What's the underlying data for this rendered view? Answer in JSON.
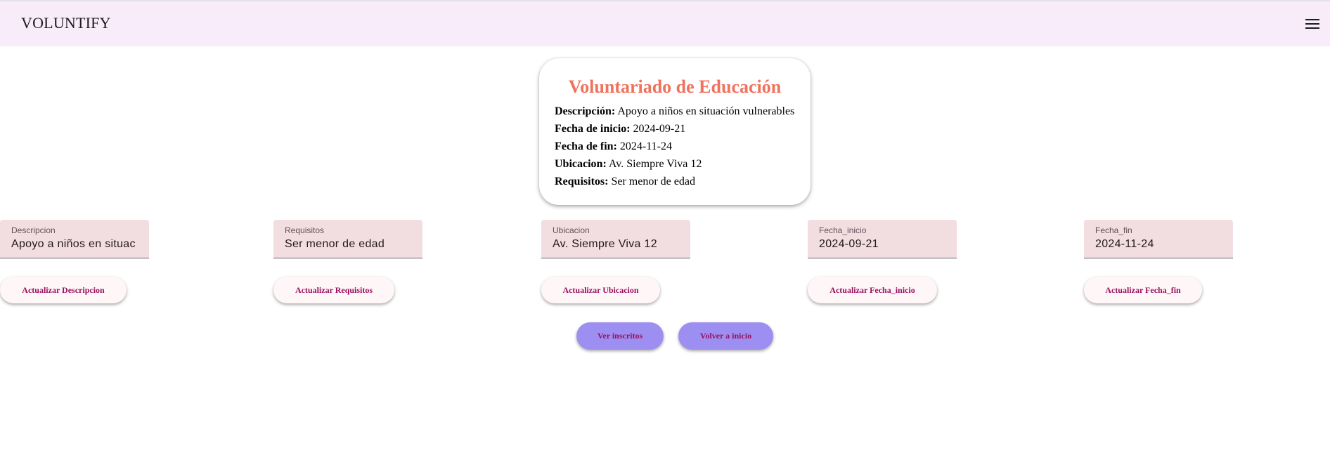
{
  "app": {
    "title": "VOLUNTIFY",
    "menu_icon": "hamburger-menu-icon"
  },
  "card": {
    "title": "Voluntariado de Educación",
    "details": [
      {
        "label": "Descripción:",
        "value": "Apoyo a niños en situación vulnerables"
      },
      {
        "label": "Fecha de inicio:",
        "value": "2024-09-21"
      },
      {
        "label": "Fecha de fin:",
        "value": "2024-11-24"
      },
      {
        "label": "Ubicacion:",
        "value": "Av. Siempre Viva 12"
      },
      {
        "label": "Requisitos:",
        "value": "Ser menor de edad"
      }
    ]
  },
  "fields": [
    {
      "label": "Descripcion",
      "value": "Apoyo a niños en situac",
      "button": "Actualizar Descripcion"
    },
    {
      "label": "Requisitos",
      "value": "Ser menor de edad",
      "button": "Actualizar Requisitos"
    },
    {
      "label": "Ubicacion",
      "value": "Av. Siempre Viva 12",
      "button": "Actualizar Ubicacion"
    },
    {
      "label": "Fecha_inicio",
      "value": "2024-09-21",
      "button": "Actualizar Fecha_inicio"
    },
    {
      "label": "Fecha_fin",
      "value": "2024-11-24",
      "button": "Actualizar Fecha_fin"
    }
  ],
  "actions": {
    "view_enrolled": "Ver inscritos",
    "back_home": "Volver a inicio"
  },
  "colors": {
    "appbar": "#f8ecfb",
    "card_title": "#f0725c",
    "field_bg": "#f2dde1",
    "button_text": "#9a1060",
    "nav_button_bg": "#9d8ff2"
  }
}
